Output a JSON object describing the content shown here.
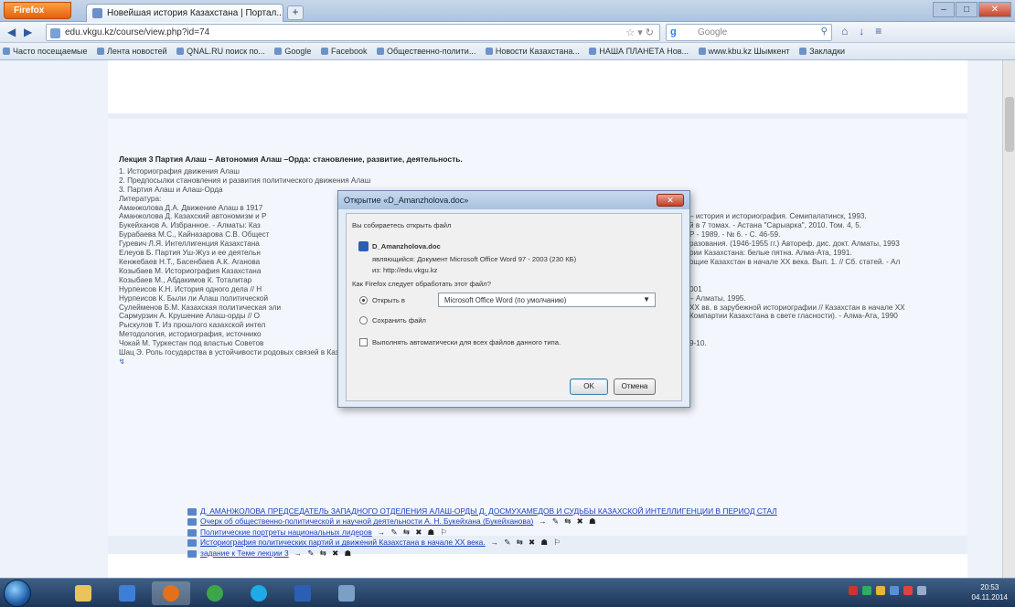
{
  "browser": {
    "menu_button": "Firefox",
    "tab_title": "Новейшая история Казахстана | Портал...",
    "new_tab": "+",
    "url": "edu.vkgu.kz/course/view.php?id=74",
    "search_placeholder": "Google",
    "nav_icons": {
      "back": "◀",
      "forward": "▶",
      "reload": "↻",
      "home": "⌂",
      "downloads": "↓",
      "menu": "≡"
    },
    "window_controls": {
      "minimize": "–",
      "maximize": "□",
      "close": "✕"
    },
    "bookmarks": [
      "Часто посещаемые",
      "Лента новостей",
      "QNAL.RU поиск по...",
      "Google",
      "Facebook",
      "Общественно-полити...",
      "Новости Казахстана...",
      "НАША ПЛАНЕТА Нов...",
      "www.kbu.kz Шымкент",
      "Закладки"
    ]
  },
  "lecture": {
    "title": "Лекция 3 Партия Алаш – Автономия Алаш –Орда: становление, развитие, деятельность.",
    "outline": [
      "1. Историография движения Алаш",
      "2. Предпосылки становления и развития политического движения Алаш",
      "3. Партия Алаш и Алаш-Орда"
    ],
    "lit_heading": "Литература:",
    "literature": [
      {
        "l": "Аманжолова Д.А. Движение Алаш в 1917",
        "r": ""
      },
      {
        "l": "Аманжолова Д. Казахский автономизм и Р",
        "r": "– история и историография. Семипалатинск, 1993."
      },
      {
        "l": "Букейханов А. Избранное. - Алматы: Каз",
        "r": "й в 7 томах. - Астана \"Сарыарка\", 2010. Том. 4, 5."
      },
      {
        "l": "Бурабаева М.С., Кайназарова С.В. Общест",
        "r": "Р - 1989. - № 6. - С. 46-59."
      },
      {
        "l": "Гуревич Л.Я. Интеллигенция Казахстана",
        "r": "разования. (1946-1955 гг.) Автореф. дис. докт. Алматы, 1993"
      },
      {
        "l": "Елеуов Б. Партия Уш-Жуз и ее деятельн",
        "r": "рии Казахстана: белые пятна. Алма-Ата, 1991."
      },
      {
        "l": "Кенжебаев Н.Т., Басенбаев А.К. Аганова",
        "r": "ощие Казахстан в начале XX века. Вып. 1. // Сб. статей. - Ал"
      },
      {
        "l": "Козыбаев М. Историография Казахстана",
        "r": ""
      },
      {
        "l": "Козыбаев М., Абдакимов К. Тоталитар",
        "r": ""
      },
      {
        "l": "Нурпеисов К.Н. История одного дела // Н",
        "r": "001"
      },
      {
        "l": "Нурпеисов К. Были ли Алаш политической",
        "r": "– Алматы, 1995."
      },
      {
        "l": "Сулейменов Б.М. Казахская политическая эли",
        "r": "XX вв. в зарубежной историографии // Казахстан в начале XX"
      },
      {
        "l": "Сармурзин А. Крушение Алаш-орды // О",
        "r": "Компартии Казахстана в свете гласности). - Алма-Ата, 1990"
      },
      {
        "l": "Рыскулов Т. Из прошлого казахской интел",
        "r": ""
      },
      {
        "l": "Методология, историография, источнико",
        "r": ""
      },
      {
        "l": "Чокай М. Туркестан под властью Советов",
        "r": "9-10."
      }
    ],
    "last_line": "Шац Э. Роль государства в устойчивости родовых связей в Казахстане // Казахстан и Россия: общество и государство. М., 2004",
    "end_mark": "↯"
  },
  "files": [
    {
      "label": "Д. АМАНЖОЛОВА ПРЕДСЕДАТЕЛЬ ЗАПАДНОГО ОТДЕЛЕНИЯ АЛАШ-ОРДЫ Д. ДОСМУХАМЕДОВ И СУДЬБЫ КАЗАХСКОЙ ИНТЕЛЛИГЕНЦИИ В ПЕРИОД СТАЛ",
      "actions": ""
    },
    {
      "label": "Очерк об общественно-политической и научной деятельности А. Н. Букейхана (Букейханова)",
      "actions": "→ ✎ ⇆ ✖ ☗"
    },
    {
      "label": "Политические портреты национальных лидеров",
      "actions": "→ ✎ ⇆ ✖ ☗ ⚐"
    },
    {
      "label": "Историография политических партий и движений Казахстана в начале XX века.",
      "actions": "→ ✎ ⇆ ✖ ☗ ⚐"
    },
    {
      "label": "задание к Теме лекции 3",
      "actions": "→ ✎ ⇆ ✖ ☗"
    }
  ],
  "dialog": {
    "title": "Открытие «D_Amanzholova.doc»",
    "intro": "Вы собираетесь открыть файл",
    "filename": "D_Amanzholova.doc",
    "type_line": "являющийся: Документ Microsoft Office Word 97 - 2003 (230 КБ)",
    "from_line": "из: http://edu.vkgu.kz",
    "question": "Как Firefox следует обработать этот файл?",
    "open_with_label": "Открыть в",
    "open_with_value": "Microsoft Office Word (по умолчанию)",
    "save_label": "Сохранить файл",
    "auto_label": "Выполнять автоматически для всех файлов данного типа.",
    "ok": "OK",
    "cancel": "Отмена",
    "close": "✕"
  },
  "taskbar": {
    "clock_time": "20:53",
    "clock_date": "04.11.2014"
  }
}
